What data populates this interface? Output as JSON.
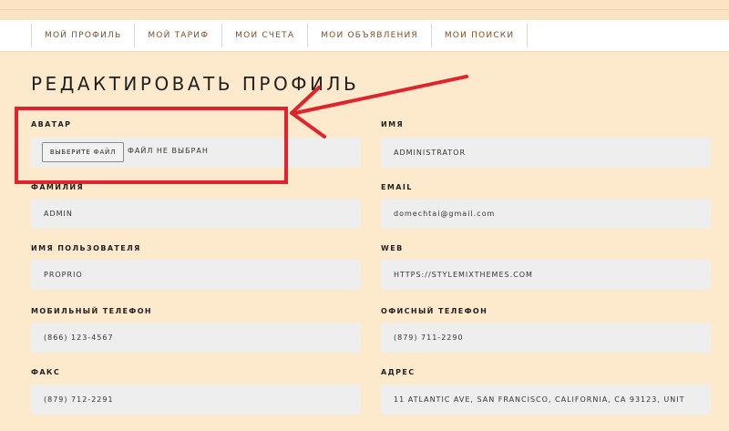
{
  "nav": {
    "items": [
      "Мой профиль",
      "Мой тариф",
      "Мои счета",
      "Мои объявления",
      "Мои поиски"
    ]
  },
  "page_title": "Редактировать профиль",
  "avatar": {
    "label": "Аватар",
    "button_label": "Выберите файл",
    "status": "Файл не выбран"
  },
  "fields": {
    "name": {
      "label": "Имя",
      "value": "Administrator"
    },
    "last_name": {
      "label": "Фамилия",
      "value": "Admin"
    },
    "email": {
      "label": "Email",
      "value": "domechtai@gmail.com"
    },
    "username": {
      "label": "Имя пользователя",
      "value": "proprio"
    },
    "web": {
      "label": "Web",
      "value": "https://stylemixthemes.com"
    },
    "mobile_phone": {
      "label": "Мобильный телефон",
      "value": "(866) 123-4567"
    },
    "office_phone": {
      "label": "Офисный телефон",
      "value": "(879) 711-2290"
    },
    "fax": {
      "label": "Факс",
      "value": "(879) 712-2291"
    },
    "address": {
      "label": "Адрес",
      "value": "11 Atlantic Ave, San Francisco, California, CA 93123, Unit"
    }
  },
  "colors": {
    "page_background": "#fde9cc",
    "annotation": "#e1232b",
    "nav_text": "#7a4e2a",
    "input_background": "#eeeeee"
  }
}
